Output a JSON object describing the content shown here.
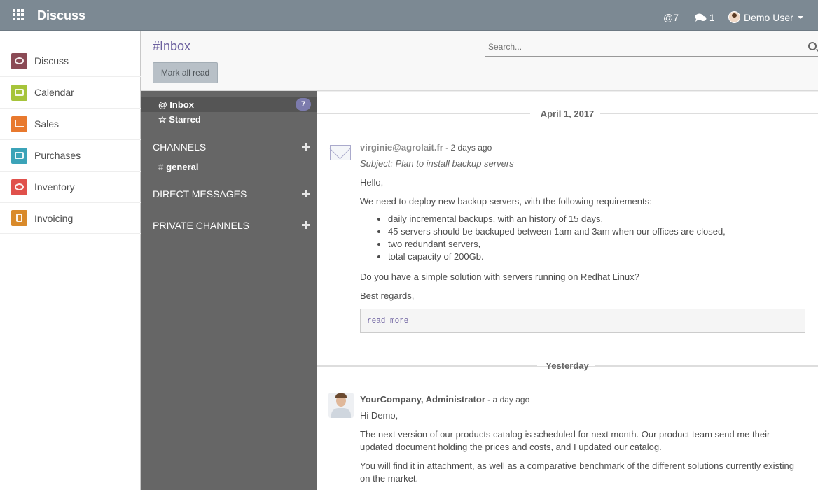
{
  "topbar": {
    "brand": "Discuss",
    "mention_count": "7",
    "chat_count": "1",
    "user_name": "Demo User"
  },
  "apps": [
    {
      "label": "Discuss",
      "color": "#8b4a55",
      "icon": "chat-bubble-icon"
    },
    {
      "label": "Calendar",
      "color": "#a6c43a",
      "icon": "calendar-icon"
    },
    {
      "label": "Sales",
      "color": "#e8792e",
      "icon": "chart-icon"
    },
    {
      "label": "Purchases",
      "color": "#3ba3b8",
      "icon": "credit-card-icon"
    },
    {
      "label": "Inventory",
      "color": "#e0504b",
      "icon": "box-icon"
    },
    {
      "label": "Invoicing",
      "color": "#d98a2a",
      "icon": "document-icon"
    }
  ],
  "control": {
    "breadcrumb": "#Inbox",
    "mark_all_read": "Mark all read",
    "search_placeholder": "Search..."
  },
  "mailboxes": {
    "inbox_label": "@ Inbox",
    "inbox_count": "7",
    "starred_label": "☆ Starred"
  },
  "sections": {
    "channels": "CHANNELS",
    "channel_general": "general",
    "direct_messages": "DIRECT MESSAGES",
    "private_channels": "PRIVATE CHANNELS"
  },
  "thread": {
    "date1": "April 1, 2017",
    "msg1": {
      "author": "virginie@agrolait.fr",
      "date": " - 2 days ago",
      "subject": "Subject: Plan to install backup servers",
      "greeting": "Hello,",
      "intro": "We need to deploy new backup servers, with the following requirements:",
      "items": [
        "daily incremental backups, with an history of 15 days,",
        "45 servers should be backuped between 1am and 3am when our offices are closed,",
        "two redundant servers,",
        "total capacity of 200Gb."
      ],
      "question": "Do you have a simple solution with servers running on Redhat Linux?",
      "closing": "Best regards,",
      "read_more": "read more"
    },
    "date2": "Yesterday",
    "msg2": {
      "author": "YourCompany, Administrator",
      "date": " - a day ago",
      "greeting": "Hi Demo,",
      "p1_line1": "The next version of our products catalog is scheduled for next month. Our product team send me their",
      "p1_line2": "updated document holding the prices and costs, and I updated our catalog.",
      "p2_line1": "You will find it in attachment, as well as a comparative benchmark of the different solutions currently existing",
      "p2_line2": "on the market."
    }
  }
}
